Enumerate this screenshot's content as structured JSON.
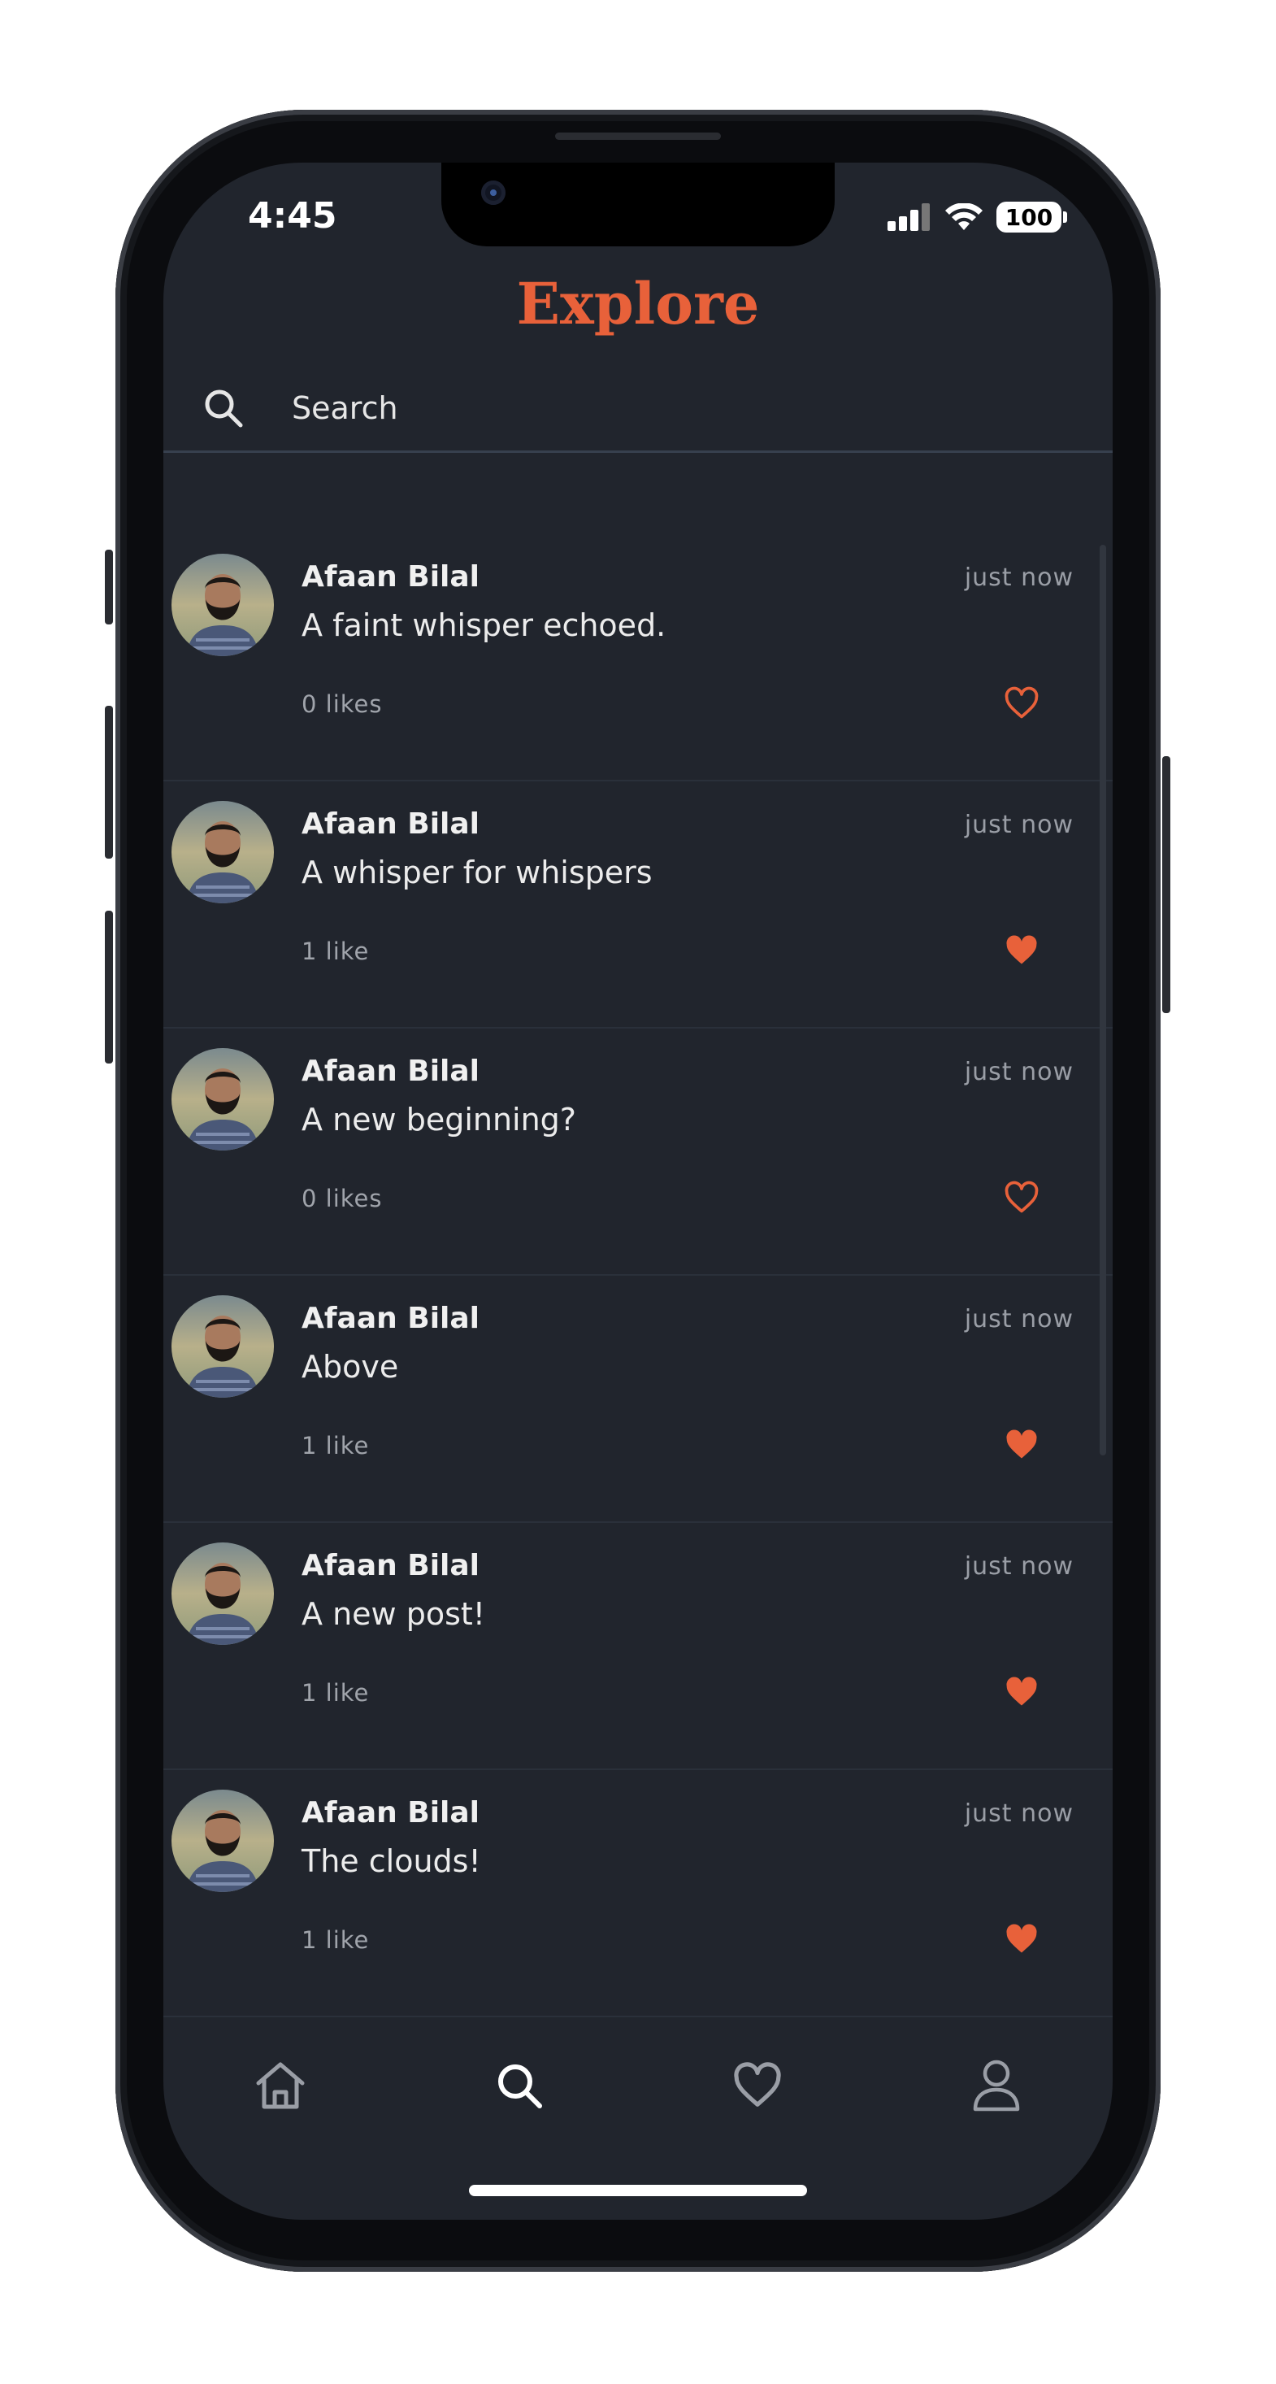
{
  "status_bar": {
    "time": "4:45",
    "battery": "100"
  },
  "header": {
    "title": "Explore"
  },
  "search": {
    "placeholder": "Search"
  },
  "posts": [
    {
      "author": "Afaan Bilal",
      "time": "just now",
      "text": "A faint whisper echoed.",
      "likes": "0 likes",
      "liked": false
    },
    {
      "author": "Afaan Bilal",
      "time": "just now",
      "text": "A whisper for whispers",
      "likes": "1 like",
      "liked": true
    },
    {
      "author": "Afaan Bilal",
      "time": "just now",
      "text": "A new beginning?",
      "likes": "0 likes",
      "liked": false
    },
    {
      "author": "Afaan Bilal",
      "time": "just now",
      "text": "Above",
      "likes": "1 like",
      "liked": true
    },
    {
      "author": "Afaan Bilal",
      "time": "just now",
      "text": "A new post!",
      "likes": "1 like",
      "liked": true
    },
    {
      "author": "Afaan Bilal",
      "time": "just now",
      "text": "The clouds!",
      "likes": "1 like",
      "liked": true
    }
  ],
  "tabbar": {
    "items": [
      {
        "icon": "home-icon",
        "active": false
      },
      {
        "icon": "search-icon",
        "active": true
      },
      {
        "icon": "heart-icon",
        "active": false
      },
      {
        "icon": "profile-icon",
        "active": false
      }
    ]
  },
  "colors": {
    "accent": "#e8613a",
    "background": "#21252d",
    "text": "#ececec",
    "muted": "#9a9ea6"
  }
}
